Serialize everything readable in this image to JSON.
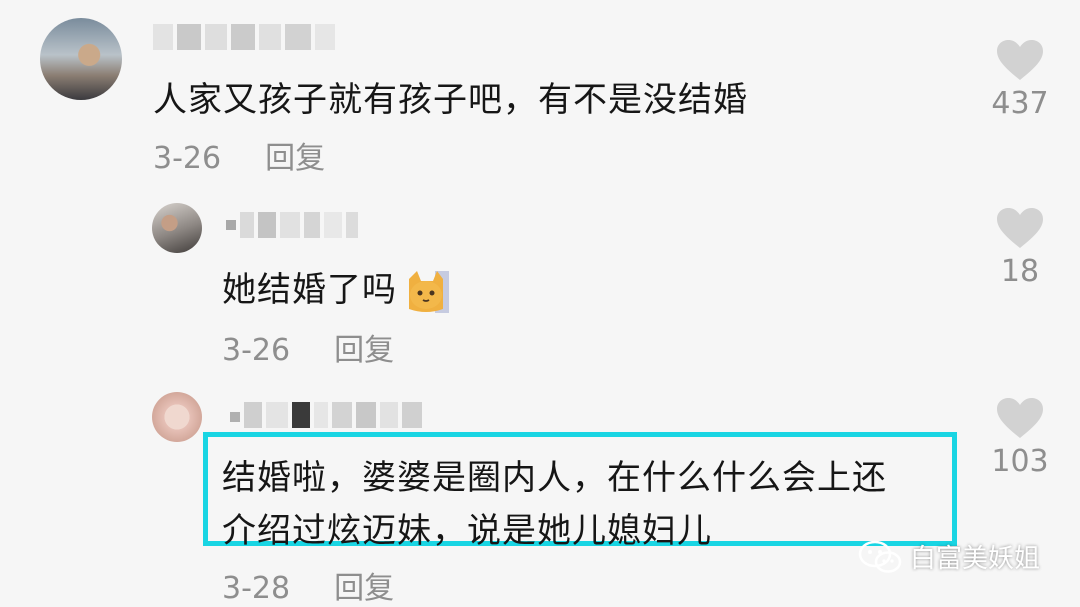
{
  "comments": [
    {
      "text": "人家又孩子就有孩子吧，有不是没结婚",
      "date": "3-26",
      "reply_label": "回复",
      "likes": "437"
    },
    {
      "text": "她结婚了吗",
      "date": "3-26",
      "reply_label": "回复",
      "likes": "18",
      "emoji": "cat-emoji"
    },
    {
      "text_line1": "结婚啦，婆婆是圈内人，在什么什么会上还",
      "text_line2": "介绍过炫迈妹，说是她儿媳妇儿",
      "date": "3-28",
      "reply_label": "回复",
      "likes": "103",
      "highlight_color": "#19d5e3"
    }
  ],
  "watermark": {
    "text": "白富美妖姐",
    "icon": "wechat-icon"
  },
  "colors": {
    "background": "#f6f6f6",
    "meta_gray": "#8e8e8e",
    "heart_gray": "#d2d2d2"
  }
}
